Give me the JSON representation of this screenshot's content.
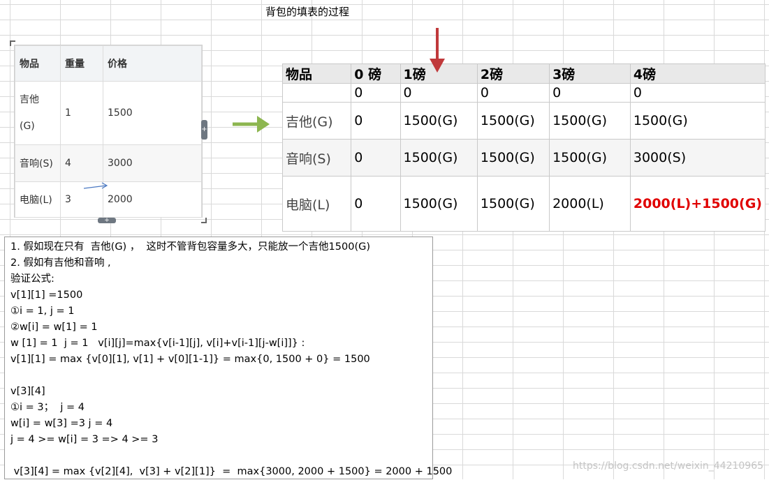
{
  "title": "背包的填表的过程",
  "items_table": {
    "headers": [
      "物品",
      "重量",
      "价格"
    ],
    "rows": [
      {
        "name_line1": "吉他",
        "name_line2": "(G)",
        "weight": "1",
        "price": "1500"
      },
      {
        "name": "音响(S)",
        "weight": "4",
        "price": "3000"
      },
      {
        "name": "电脑(L)",
        "weight": "3",
        "price": "2000"
      }
    ],
    "handle_right": "+",
    "handle_bottom": "+"
  },
  "knapsack_table": {
    "headers": [
      "物品",
      "0 磅",
      "1磅",
      "2磅",
      "3磅",
      "4磅"
    ],
    "zero_row": [
      "",
      "0",
      "0",
      "0",
      "0",
      "0"
    ],
    "rows": [
      [
        "吉他(G)",
        "0",
        "1500(G)",
        "1500(G)",
        "1500(G)",
        "1500(G)"
      ],
      [
        "音响(S)",
        "0",
        "1500(G)",
        "1500(G)",
        "1500(G)",
        "3000(S)"
      ],
      [
        "电脑(L)",
        "0",
        "1500(G)",
        "1500(G)",
        "2000(L)",
        "2000(L)+1500(G)"
      ]
    ],
    "highlight_color": "#e00000"
  },
  "notes": [
    "1. 假如现在只有  吉他(G) ，  这时不管背包容量多大，只能放一个吉他1500(G)",
    "2. 假如有吉他和音响 ,",
    "验证公式:",
    "v[1][1] =1500",
    "①i = 1, j = 1",
    "②w[i] = w[1] = 1",
    "w [1] = 1  j = 1   v[i][j]=max{v[i-1][j], v[i]+v[i-1][j-w[i]]} :",
    "v[1][1] = max {v[0][1], v[1] + v[0][1-1]} = max{0, 1500 + 0} = 1500",
    "",
    "v[3][4]",
    "①i = 3；  j = 4",
    "w[i] = w[3] =3 j = 4",
    "j = 4 >= w[i] = 3 => 4 >= 3",
    "",
    " v[3][4] = max {v[2][4],  v[3] + v[2][1]}  =  max{3000, 2000 + 1500} = 2000 + 1500"
  ],
  "watermark": "https://blog.csdn.net/weixin_44210965",
  "colors": {
    "arrow_green": "#8db650",
    "arrow_red": "#c0393b",
    "arrow_blue": "#4a78c2"
  }
}
